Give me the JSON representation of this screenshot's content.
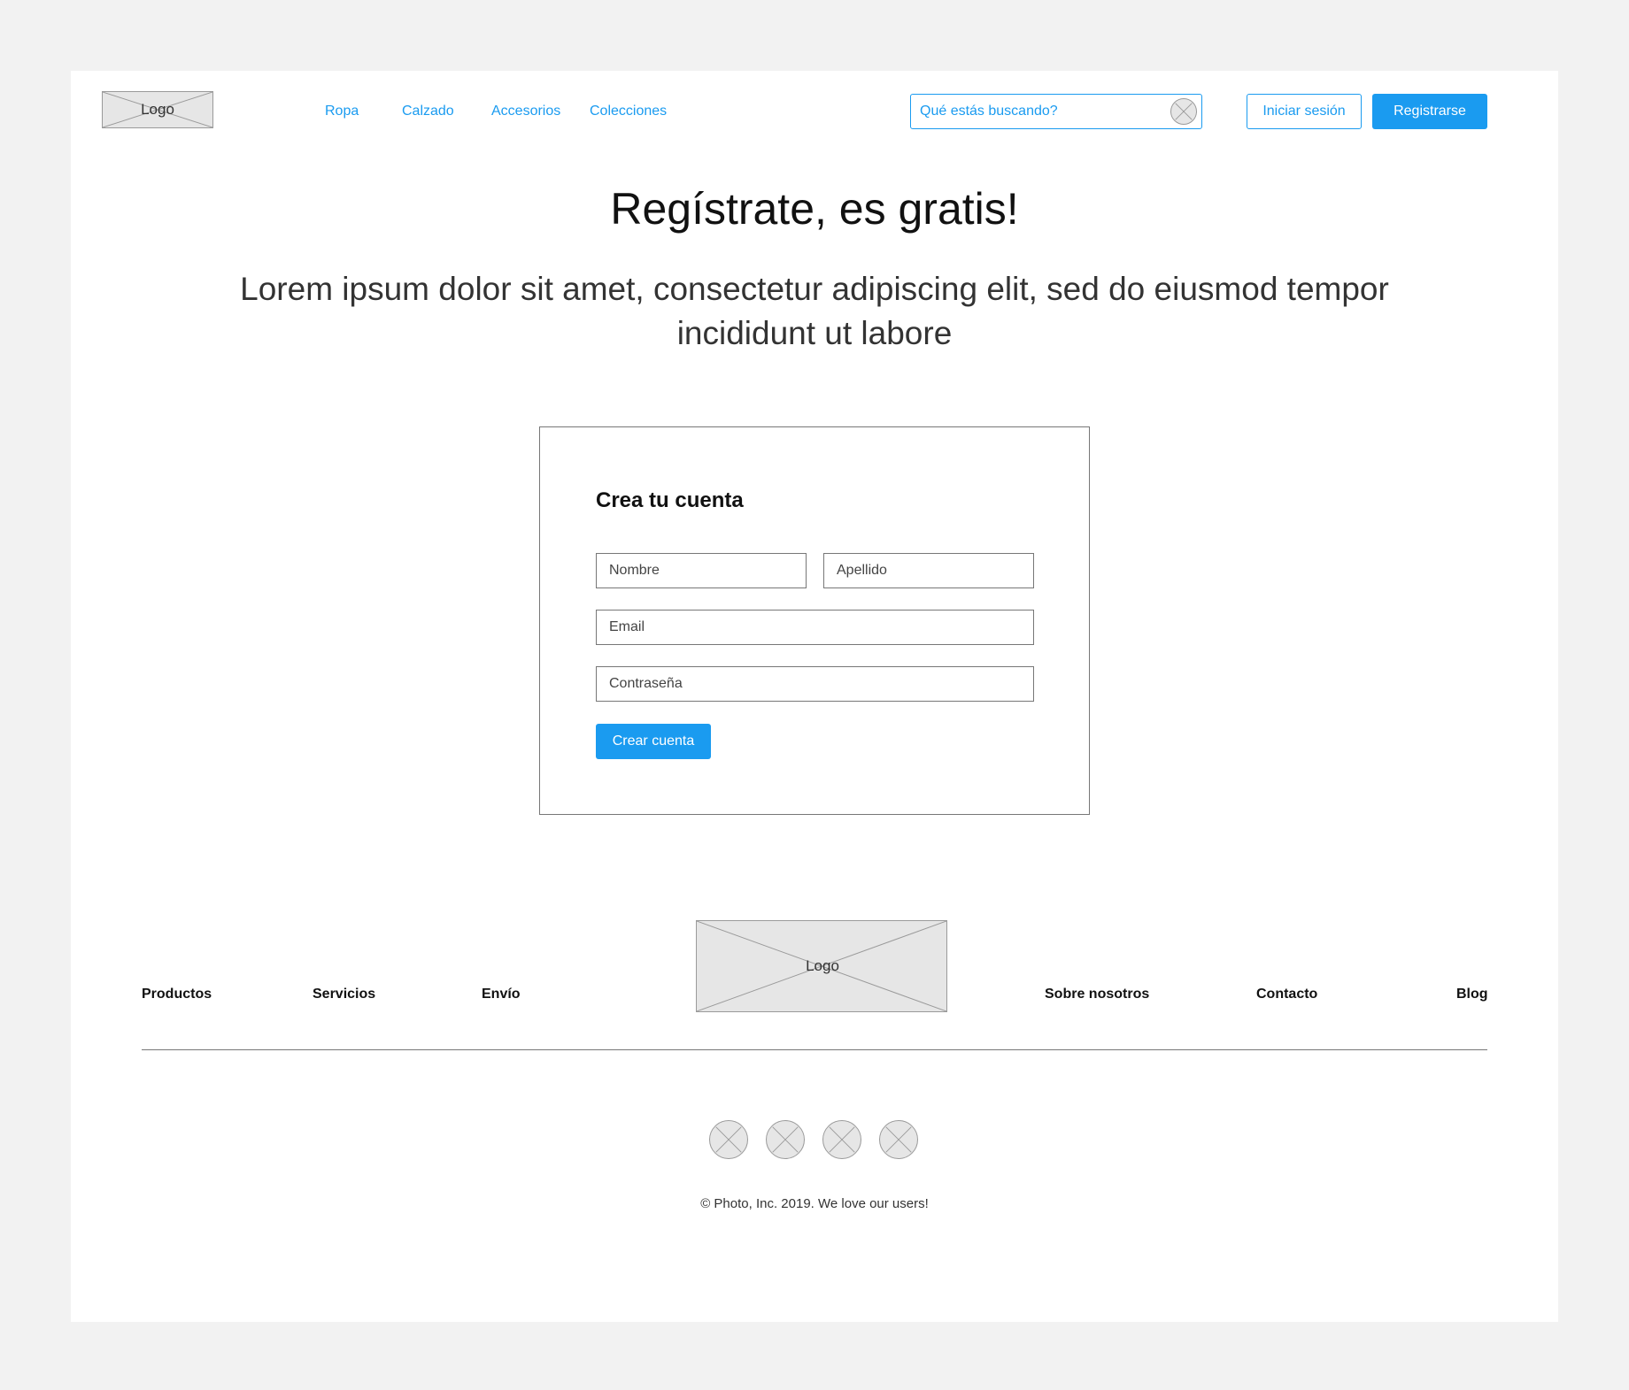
{
  "header": {
    "logo_label": "Logo",
    "nav": [
      "Ropa",
      "Calzado",
      "Accesorios",
      "Colecciones"
    ],
    "search_placeholder": "Qué estás buscando?",
    "login_label": "Iniciar sesión",
    "signup_label": "Registrarse"
  },
  "hero": {
    "title": "Regístrate, es gratis!",
    "subtitle": "Lorem ipsum dolor sit amet, consectetur adipiscing elit, sed do eiusmod tempor incididunt ut labore"
  },
  "form": {
    "title": "Crea tu cuenta",
    "first_name_placeholder": "Nombre",
    "last_name_placeholder": "Apellido",
    "email_placeholder": "Email",
    "password_placeholder": "Contraseña",
    "submit_label": "Crear cuenta"
  },
  "footer": {
    "logo_label": "Logo",
    "links_left": [
      "Productos",
      "Servicios",
      "Envío"
    ],
    "links_right": [
      "Sobre nosotros",
      "Contacto",
      "Blog"
    ],
    "copyright": "© Photo, Inc. 2019. We love our users!"
  },
  "colors": {
    "accent": "#1a9bf0",
    "background": "#f2f2f2",
    "placeholder_fill": "#e6e6e6"
  }
}
